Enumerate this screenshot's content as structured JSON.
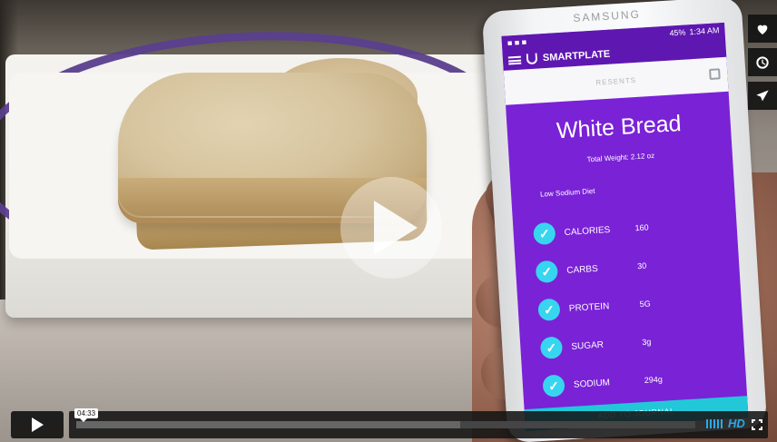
{
  "player": {
    "current_time": "04:33",
    "progress": 0.0,
    "buffered": 0.62,
    "hd_label": "HD",
    "accent_color": "#2aa9e8",
    "icons": {
      "play_overlay": "play-icon",
      "like": "heart-icon",
      "watch_later": "clock-icon",
      "share": "paper-plane-icon",
      "volume": "volume-bars-icon",
      "fullscreen": "fullscreen-icon"
    }
  },
  "phone": {
    "brand": "SAMSUNG",
    "status_time": "1:34 AM",
    "status_battery": "45%",
    "app_name": "SMARTPLATE",
    "search_placeholder": "RESENTS",
    "food_name": "White Bread",
    "total_weight": "Total Weight: 2.12 oz",
    "diet": "Low Sodium Diet",
    "nutrients": [
      {
        "name": "CALORIES",
        "value": "160"
      },
      {
        "name": "CARBS",
        "value": "30"
      },
      {
        "name": "PROTEIN",
        "value": "5G"
      },
      {
        "name": "SUGAR",
        "value": "3g"
      },
      {
        "name": "SODIUM",
        "value": "294g"
      }
    ],
    "bottom_action": "ADD TO JOURNAL",
    "colors": {
      "screen": "#7a22d6",
      "appbar": "#5e17b0",
      "check": "#37d6f0",
      "bottom_action": "#22c8d8"
    }
  }
}
